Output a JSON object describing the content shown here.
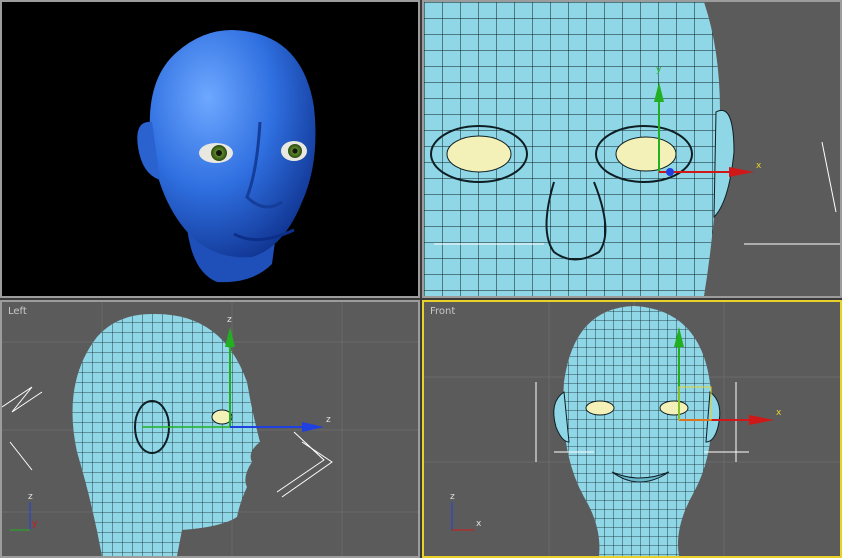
{
  "viewports": {
    "perspective": {
      "label": ""
    },
    "top": {
      "label": ""
    },
    "left": {
      "label": "Left"
    },
    "front": {
      "label": "Front",
      "active": true
    }
  },
  "gizmo": {
    "x": "x",
    "y": "y",
    "z": "z"
  },
  "colors": {
    "viewport_bg": "#5b5b5b",
    "active_border": "#e8d22a",
    "mesh": "#8fd6e6",
    "wire": "#0e1e22",
    "skin_render": "#2f6fe0",
    "eye_white": "#f3f0b8",
    "axis_x": "#d01818",
    "axis_y": "#22b022",
    "axis_z": "#2040e0"
  }
}
